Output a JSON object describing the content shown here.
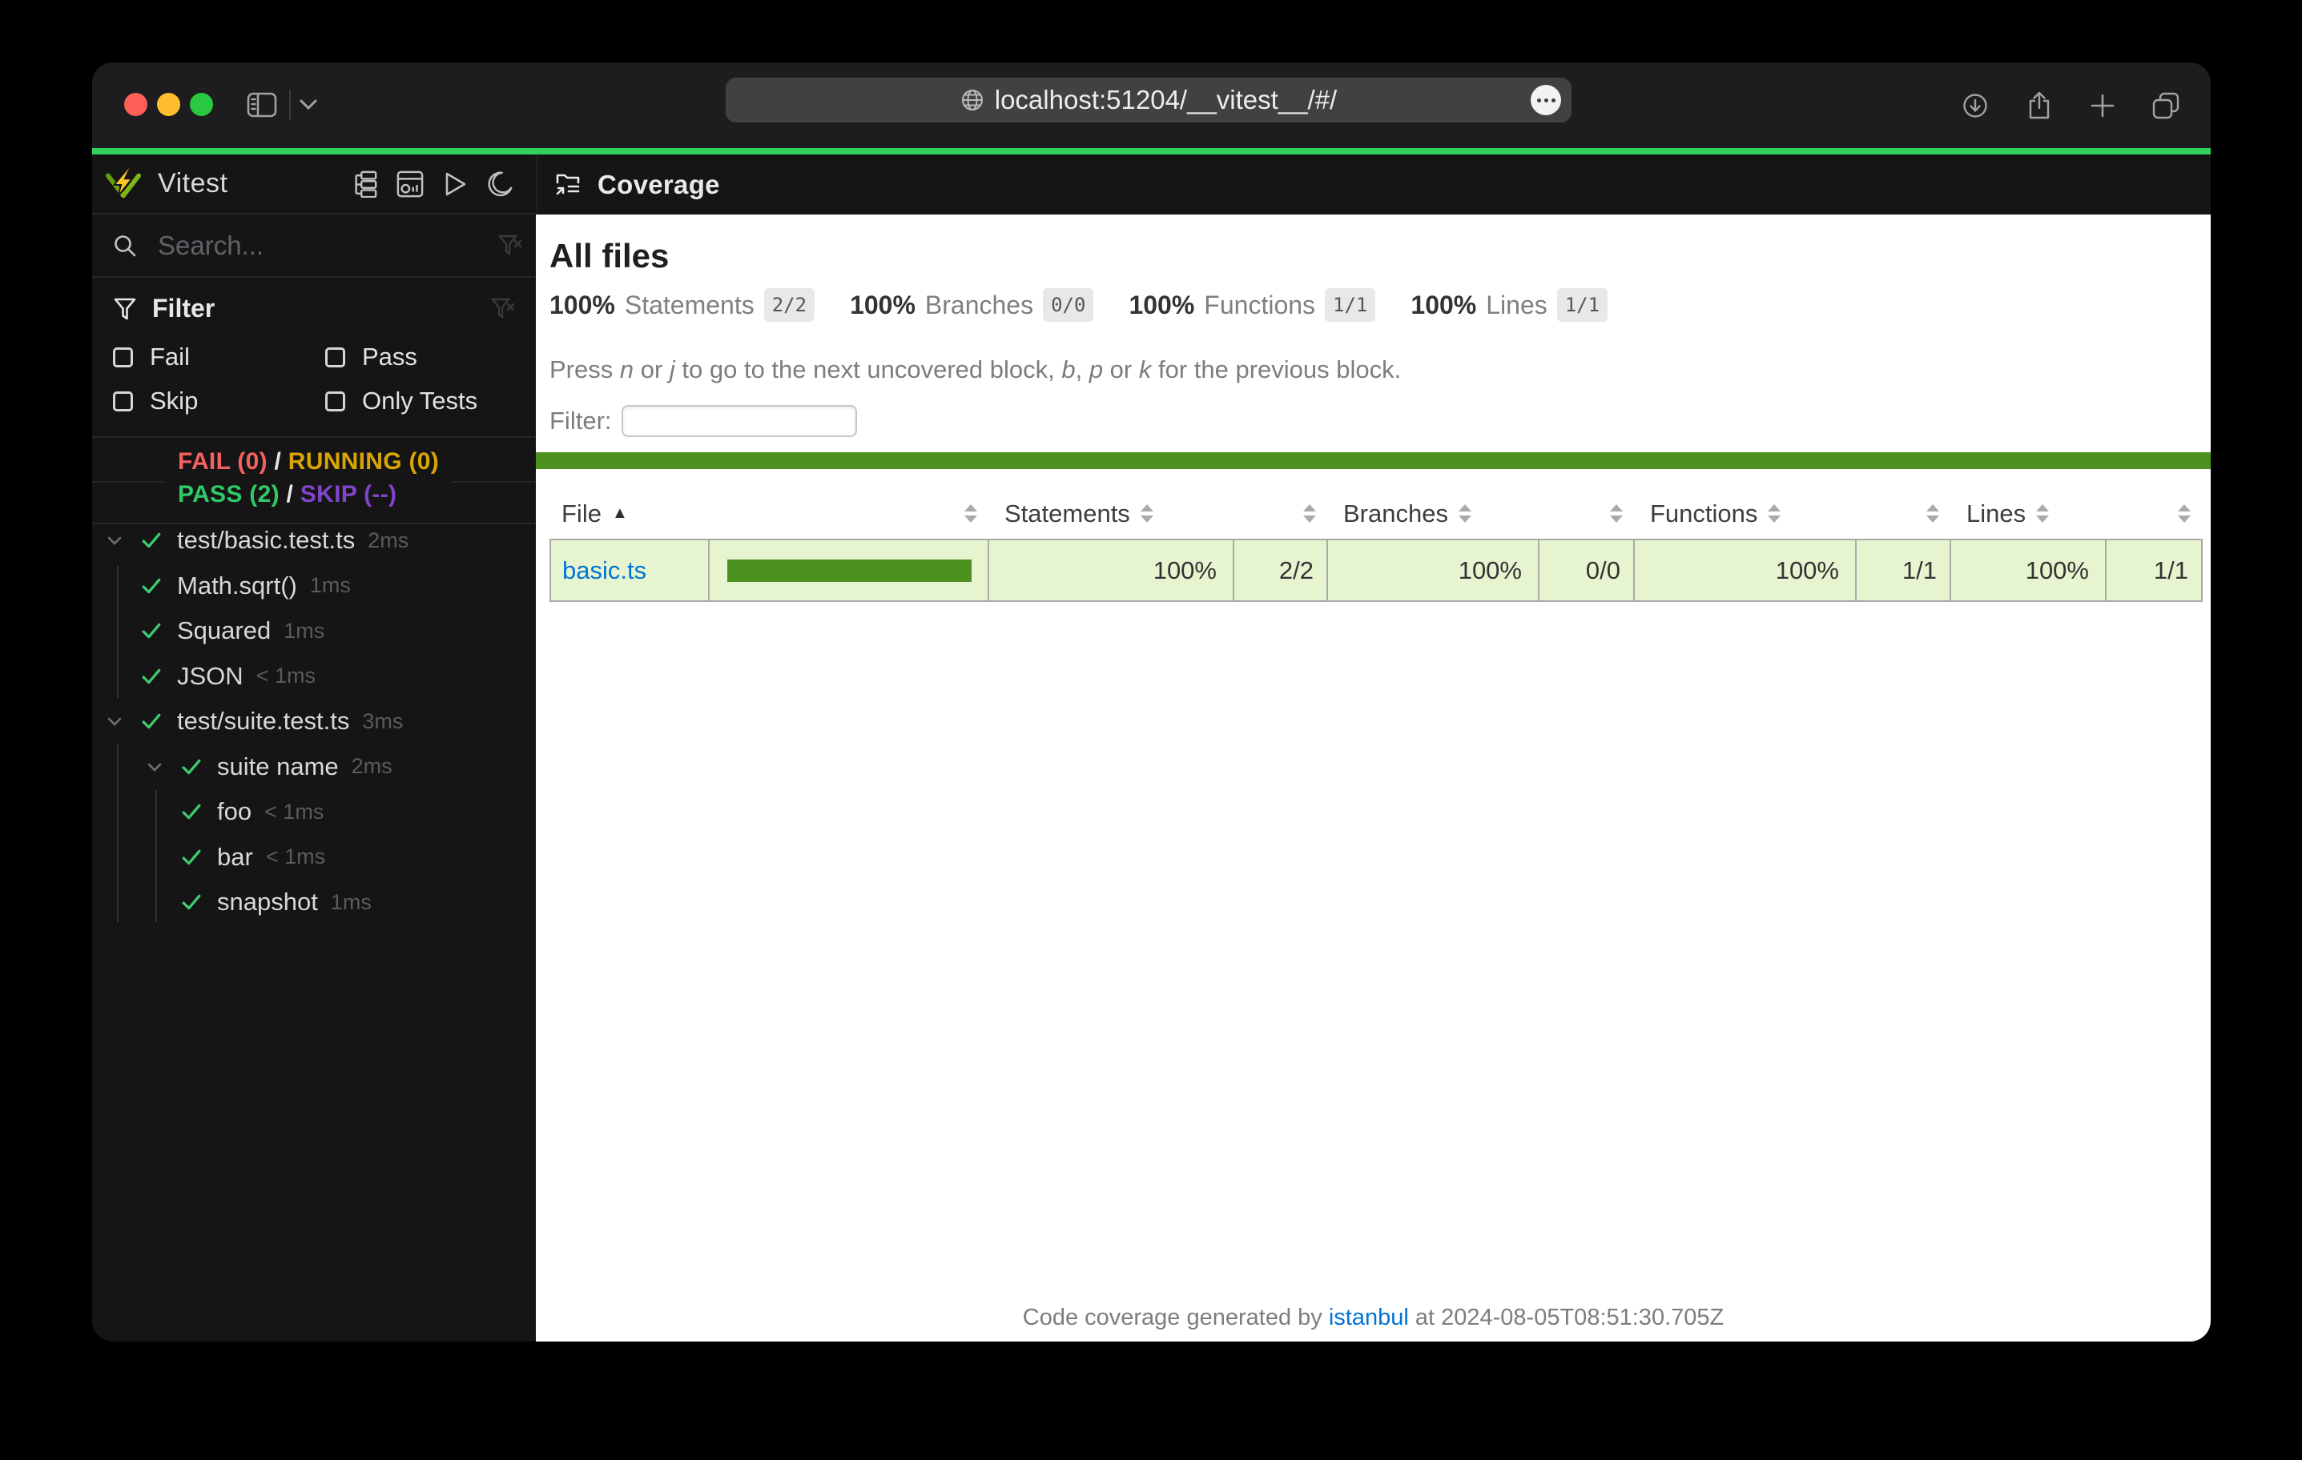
{
  "browser": {
    "url": "localhost:51204/__vitest__/#/"
  },
  "app": {
    "brand": "Vitest",
    "search_placeholder": "Search...",
    "filter": {
      "title": "Filter",
      "options": [
        "Fail",
        "Pass",
        "Skip",
        "Only Tests"
      ]
    },
    "status": {
      "fail": "FAIL (0)",
      "running": "RUNNING (0)",
      "pass": "PASS (2)",
      "skip": "SKIP (--)",
      "sep": "/"
    },
    "tree": [
      {
        "label": "test/basic.test.ts",
        "duration": "2ms"
      },
      {
        "label": "Math.sqrt()",
        "duration": "1ms"
      },
      {
        "label": "Squared",
        "duration": "1ms"
      },
      {
        "label": "JSON",
        "duration": "< 1ms"
      },
      {
        "label": "test/suite.test.ts",
        "duration": "3ms"
      },
      {
        "label": "suite name",
        "duration": "2ms"
      },
      {
        "label": "foo",
        "duration": "< 1ms"
      },
      {
        "label": "bar",
        "duration": "< 1ms"
      },
      {
        "label": "snapshot",
        "duration": "1ms"
      }
    ]
  },
  "main": {
    "title": "Coverage",
    "page_heading": "All files",
    "stats": [
      {
        "pct": "100%",
        "label": "Statements",
        "fraction": "2/2"
      },
      {
        "pct": "100%",
        "label": "Branches",
        "fraction": "0/0"
      },
      {
        "pct": "100%",
        "label": "Functions",
        "fraction": "1/1"
      },
      {
        "pct": "100%",
        "label": "Lines",
        "fraction": "1/1"
      }
    ],
    "help": {
      "parts": [
        "Press ",
        "n",
        " or ",
        "j",
        " to go to the next uncovered block, ",
        "b",
        ", ",
        "p",
        " or ",
        "k",
        " for the previous block."
      ]
    },
    "filter_label": "Filter:",
    "table": {
      "headers": {
        "file": "File",
        "statements": "Statements",
        "branches": "Branches",
        "functions": "Functions",
        "lines": "Lines"
      },
      "sort_indicator": "▲",
      "rows": [
        {
          "file": "basic.ts",
          "bar_pct": 100,
          "statements_pct": "100%",
          "statements_frac": "2/2",
          "branches_pct": "100%",
          "branches_frac": "0/0",
          "functions_pct": "100%",
          "functions_frac": "1/1",
          "lines_pct": "100%",
          "lines_frac": "1/1"
        }
      ]
    },
    "footer": {
      "pre": "Code coverage generated by ",
      "link": "istanbul",
      "post": " at 2024-08-05T08:51:30.705Z"
    }
  },
  "colors": {
    "top_progress": "#30d15d",
    "coverage_green": "#4d9221",
    "coverage_light": "#e6f5d0",
    "link_blue": "#0074d9",
    "fail_red": "#f56060",
    "running_yellow": "#d9a406",
    "pass_green": "#2fc968",
    "skip_purple": "#8145cc"
  }
}
